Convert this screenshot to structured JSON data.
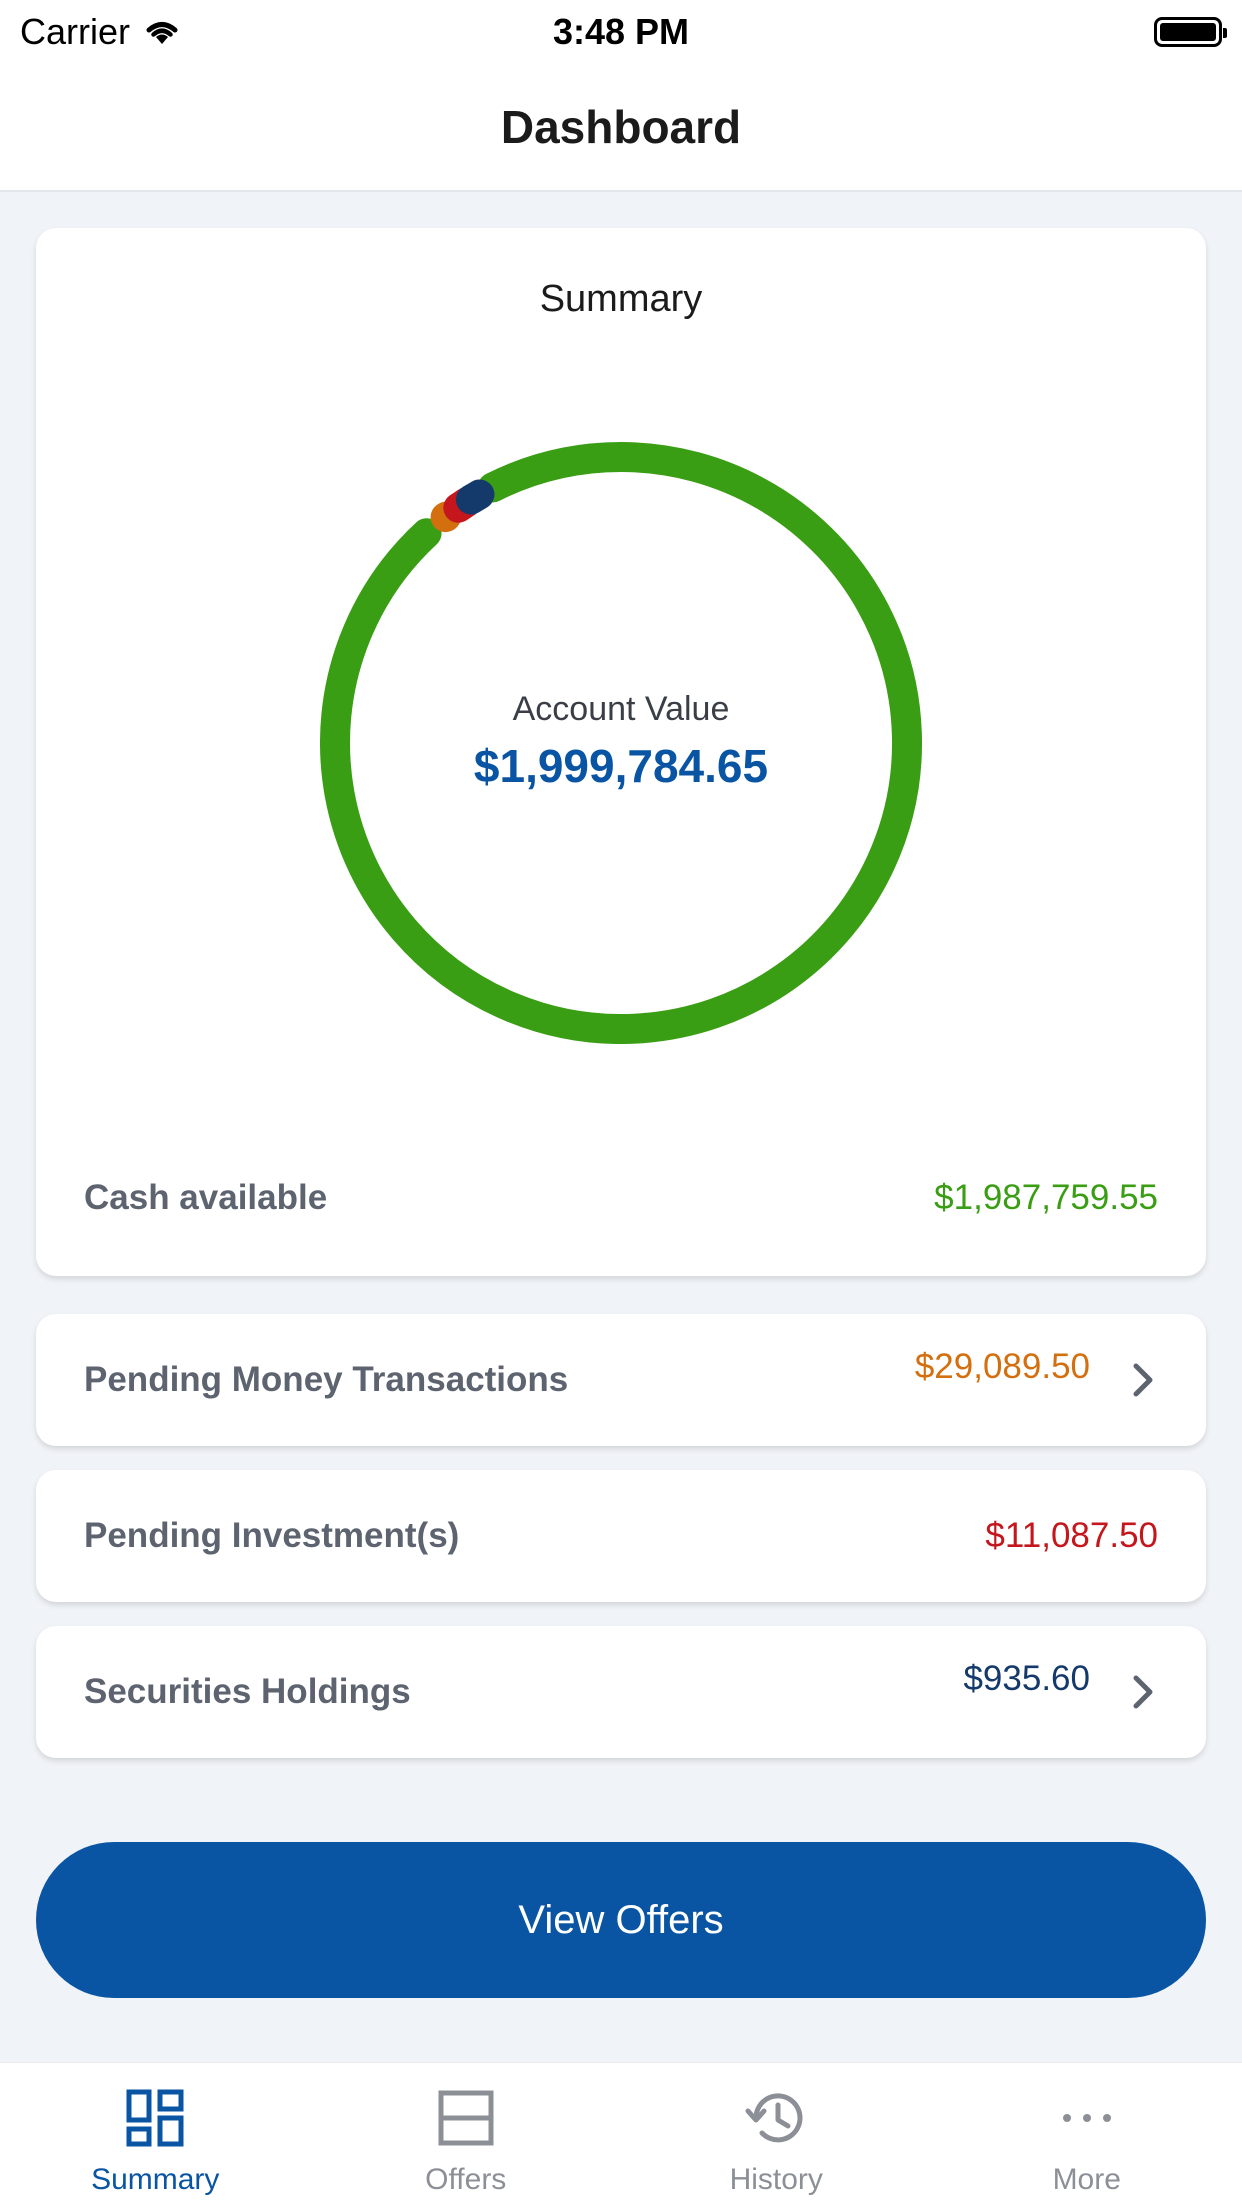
{
  "status_bar": {
    "carrier": "Carrier",
    "time": "3:48 PM"
  },
  "nav": {
    "title": "Dashboard"
  },
  "summary": {
    "title": "Summary",
    "account_label": "Account Value",
    "account_value": "$1,999,784.65",
    "cash_label": "Cash available",
    "cash_value": "$1,987,759.55"
  },
  "chart_data": {
    "type": "pie",
    "style": "donut",
    "series": [
      {
        "values": [
          1987759.55,
          29089.5,
          11087.5,
          935.6
        ]
      }
    ],
    "colors": [
      "#3a9e14",
      "#d46f0f",
      "#c4161c",
      "#14396b"
    ]
  },
  "rows": [
    {
      "label": "Pending Money Transactions",
      "value": "$29,089.50",
      "has_chevron": true,
      "color": "#d46f0f"
    },
    {
      "label": "Pending Investment(s)",
      "value": "$11,087.50",
      "has_chevron": false,
      "color": "#c4161c"
    },
    {
      "label": "Securities Holdings",
      "value": "$935.60",
      "has_chevron": true,
      "color": "#14396b"
    }
  ],
  "cta": {
    "label": "View Offers"
  },
  "tabs": [
    {
      "label": "Summary",
      "icon": "dashboard-icon",
      "active": true
    },
    {
      "label": "Offers",
      "icon": "offers-icon",
      "active": false
    },
    {
      "label": "History",
      "icon": "history-icon",
      "active": false
    },
    {
      "label": "More",
      "icon": "more-icon",
      "active": false
    }
  ],
  "colors": {
    "accent": "#0a55a3",
    "inactive": "#8c9096"
  }
}
